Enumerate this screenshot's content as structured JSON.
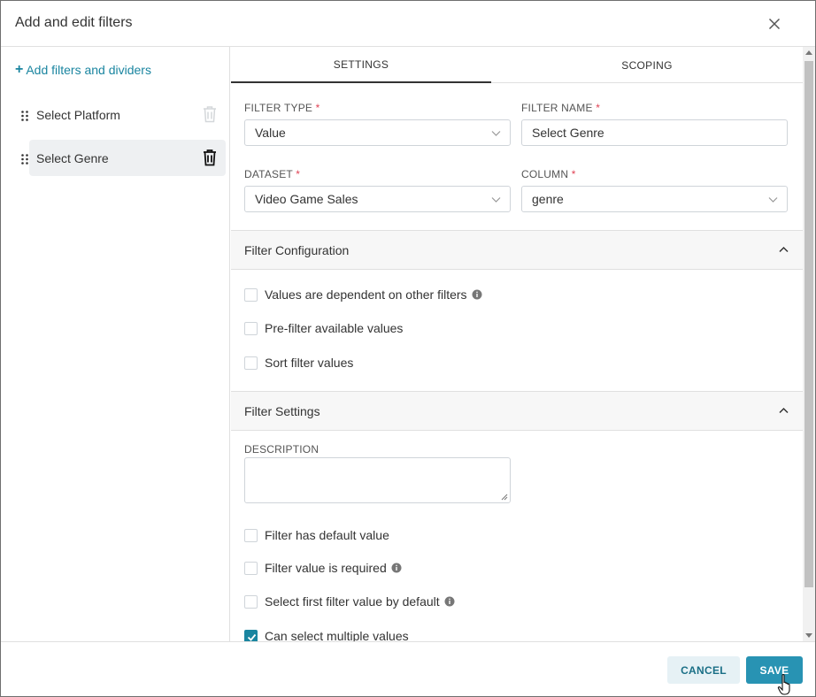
{
  "modal": {
    "title": "Add and edit filters"
  },
  "sidebar": {
    "add_label": "Add filters and dividers",
    "items": [
      {
        "label": "Select Platform",
        "active": false
      },
      {
        "label": "Select Genre",
        "active": true
      }
    ]
  },
  "tabs": [
    {
      "label": "SETTINGS",
      "active": true
    },
    {
      "label": "SCOPING",
      "active": false
    }
  ],
  "form": {
    "filter_type": {
      "label": "FILTER TYPE",
      "required_mark": "*",
      "value": "Value"
    },
    "filter_name": {
      "label": "FILTER NAME",
      "required_mark": "*",
      "value": "Select Genre"
    },
    "dataset": {
      "label": "DATASET",
      "required_mark": "*",
      "value": "Video Game Sales"
    },
    "column": {
      "label": "COLUMN",
      "required_mark": "*",
      "value": "genre"
    }
  },
  "filter_configuration": {
    "title": "Filter Configuration",
    "options": [
      {
        "label": "Values are dependent on other filters",
        "checked": false,
        "info": true
      },
      {
        "label": "Pre-filter available values",
        "checked": false,
        "info": false
      },
      {
        "label": "Sort filter values",
        "checked": false,
        "info": false
      }
    ]
  },
  "filter_settings": {
    "title": "Filter Settings",
    "description_label": "DESCRIPTION",
    "description_value": "",
    "options": [
      {
        "label": "Filter has default value",
        "checked": false,
        "info": false
      },
      {
        "label": "Filter value is required",
        "checked": false,
        "info": true
      },
      {
        "label": "Select first filter value by default",
        "checked": false,
        "info": true
      },
      {
        "label": "Can select multiple values",
        "checked": true,
        "info": false
      }
    ]
  },
  "footer": {
    "cancel_label": "CANCEL",
    "save_label": "SAVE"
  },
  "colors": {
    "accent": "#1a85a0",
    "primary_button": "#2893b3",
    "required": "#e04355"
  }
}
